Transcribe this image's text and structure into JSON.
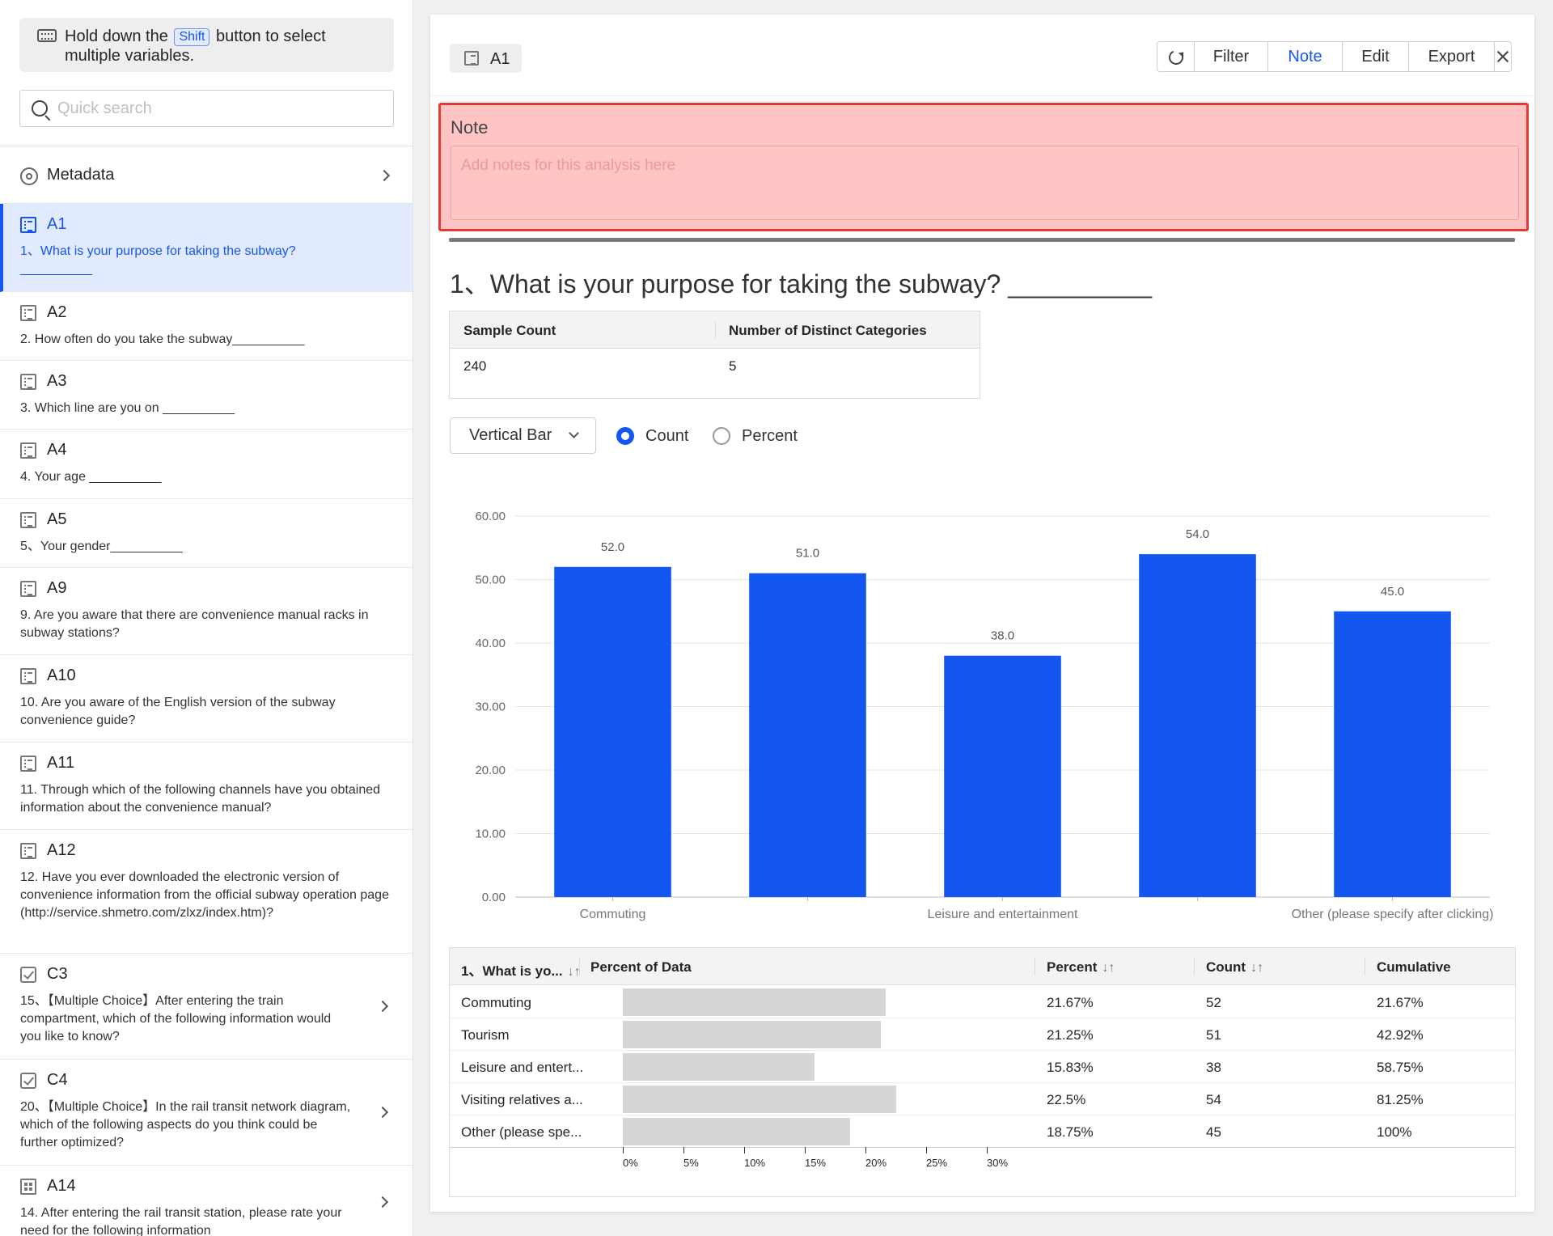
{
  "sidebar": {
    "hint_before": "Hold down the",
    "hint_key": "Shift",
    "hint_after": "button to select multiple variables.",
    "search_placeholder": "Quick search",
    "metadata_label": "Metadata",
    "items": [
      {
        "code": "A1",
        "question": "1、What is your purpose for taking the subway? __________",
        "icon": "list-icon",
        "active": true
      },
      {
        "code": "A2",
        "question": "2. How often do you take the subway__________",
        "icon": "list-icon"
      },
      {
        "code": "A3",
        "question": "3. Which line are you on __________",
        "icon": "list-icon"
      },
      {
        "code": "A4",
        "question": "4. Your age __________",
        "icon": "list-icon"
      },
      {
        "code": "A5",
        "question": "5、Your gender__________",
        "icon": "list-icon"
      },
      {
        "code": "A9",
        "question": "9. Are you aware that there are convenience manual racks in subway stations?",
        "icon": "list-icon"
      },
      {
        "code": "A10",
        "question": "10. Are you aware of the English version of the subway convenience guide?",
        "icon": "list-icon"
      },
      {
        "code": "A11",
        "question": "11. Through which of the following channels have you obtained information about the convenience manual?",
        "icon": "list-icon"
      },
      {
        "code": "A12",
        "question": "12. Have you ever downloaded the electronic version of convenience information from the official subway operation page (http://service.shmetro.com/zlxz/index.htm)?",
        "icon": "list-icon"
      },
      {
        "code": "C3",
        "question": "15、【Multiple Choice】After entering the train compartment, which of the following information would you like to know?",
        "icon": "check-icon",
        "chevron": true
      },
      {
        "code": "C4",
        "question": "20、【Multiple Choice】In the rail transit network diagram, which of the following aspects do you think could be further optimized?",
        "icon": "check-icon",
        "chevron": true
      },
      {
        "code": "A14",
        "question": "14. After entering the rail transit station, please rate your need for the following information",
        "icon": "matrix-icon",
        "chevron": true
      }
    ]
  },
  "main": {
    "variable_chip": "A1",
    "toolbar": {
      "filter": "Filter",
      "note": "Note",
      "edit": "Edit",
      "export": "Export"
    },
    "note_title": "Note",
    "note_placeholder": "Add notes for this analysis here",
    "question_title": "1、What is your purpose for taking the subway? __________",
    "stats": {
      "headers": [
        "Sample Count",
        "Number of Distinct Categories"
      ],
      "values": [
        "240",
        "5"
      ]
    },
    "chart_type": "Vertical Bar",
    "radio_count": "Count",
    "radio_percent": "Percent",
    "freq_table": {
      "headers": [
        "1、What is yo...",
        "Percent of Data",
        "Percent",
        "Count",
        "Cumulative"
      ],
      "rows": [
        {
          "label": "Commuting",
          "pct_value": 21.67,
          "percent": "21.67%",
          "count": "52",
          "cumulative": "21.67%"
        },
        {
          "label": "Tourism",
          "pct_value": 21.25,
          "percent": "21.25%",
          "count": "51",
          "cumulative": "42.92%"
        },
        {
          "label": "Leisure and entert...",
          "pct_value": 15.83,
          "percent": "15.83%",
          "count": "38",
          "cumulative": "58.75%"
        },
        {
          "label": "Visiting relatives a...",
          "pct_value": 22.5,
          "percent": "22.5%",
          "count": "54",
          "cumulative": "81.25%"
        },
        {
          "label": "Other (please spe...",
          "pct_value": 18.75,
          "percent": "18.75%",
          "count": "45",
          "cumulative": "100%"
        }
      ],
      "axis_ticks": [
        "0%",
        "5%",
        "10%",
        "15%",
        "20%",
        "25%",
        "30%"
      ]
    }
  },
  "chart_data": {
    "type": "bar",
    "categories": [
      "Commuting",
      "Tourism",
      "Leisure and entertainment",
      "Visiting relatives",
      "Other (please specify after clicking)"
    ],
    "visible_category_labels": [
      "Commuting",
      "",
      "Leisure and entertainment",
      "",
      "Other (please specify after clicking)"
    ],
    "values": [
      52.0,
      51.0,
      38.0,
      54.0,
      45.0
    ],
    "value_labels": [
      "52.0",
      "51.0",
      "38.0",
      "54.0",
      "45.0"
    ],
    "y_ticks": [
      "0.00",
      "10.00",
      "20.00",
      "30.00",
      "40.00",
      "50.00",
      "60.00"
    ],
    "ylim": [
      0,
      60
    ],
    "grid": true,
    "bar_color": "#1456f0",
    "title": "",
    "xlabel": "",
    "ylabel": ""
  }
}
